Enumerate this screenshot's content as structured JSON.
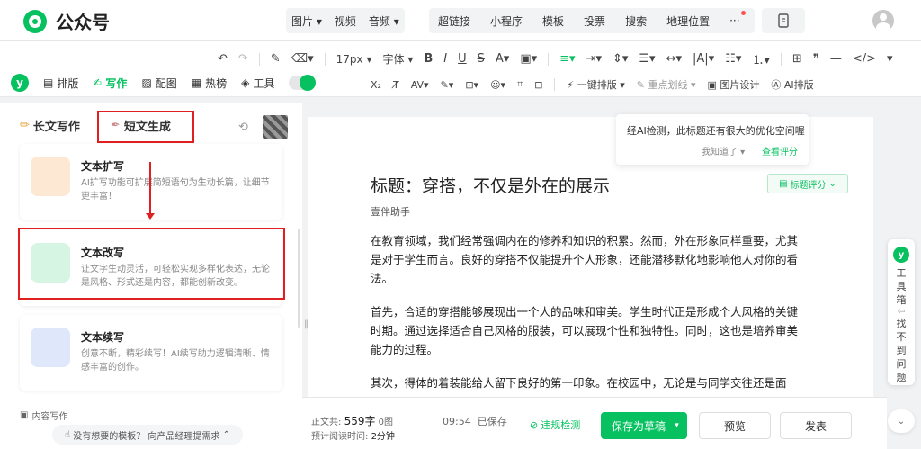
{
  "header": {
    "logo_text": "公众号",
    "media": [
      "图片",
      "视频",
      "音频"
    ],
    "insert": [
      "超链接",
      "小程序",
      "模板",
      "投票",
      "搜索",
      "地理位置"
    ],
    "more": "···"
  },
  "toolbar": {
    "font_size": "17px",
    "font_family": "字体",
    "one_click_layout": "一键排版",
    "key_point": "重点划线",
    "image_design": "图片设计",
    "ai_layout": "AI排版"
  },
  "side_tabs": {
    "logo_letter": "y",
    "items": [
      "排版",
      "写作",
      "配图",
      "热榜",
      "工具"
    ]
  },
  "left_panel": {
    "mode_long": "长文写作",
    "mode_short": "短文生成",
    "cards": [
      {
        "title": "文本扩写",
        "desc": "AI扩写功能可扩展简短语句为生动长篇，让细节更丰富！"
      },
      {
        "title": "文本改写",
        "desc": "让文字生动灵活，可轻松实现多样化表达，无论是风格、形式还是内容，都能创新改变。"
      },
      {
        "title": "文本续写",
        "desc": "创意不断，精彩续写！AI续写助力逻辑清晰、情感丰富的创作。"
      }
    ],
    "section_label": "内容写作",
    "feedback": "没有想要的模板？ 向产品经理提需求"
  },
  "ai_tip": {
    "text": "经AI检测，此标题还有很大的优化空间喔",
    "dismiss": "我知道了",
    "view": "查看评分"
  },
  "article": {
    "title": "标题：穿搭，不仅是外在的展示",
    "title_score": "标题评分",
    "author": "壹伴助手",
    "paragraphs": [
      "在教育领域，我们经常强调内在的修养和知识的积累。然而，外在形象同样重要，尤其是对于学生而言。良好的穿搭不仅能提升个人形象，还能潜移默化地影响他人对你的看法。",
      "首先，合适的穿搭能够展现出一个人的品味和审美。学生时代正是形成个人风格的关键时期。通过选择适合自己风格的服装，可以展现个性和独特性。同时，这也是培养审美能力的过程。",
      "其次，得体的着装能给人留下良好的第一印象。在校园中，无论是与同学交往还是面"
    ]
  },
  "right_float": {
    "logo_letter": "y",
    "toolbox": "工具箱",
    "find": "找不到问题"
  },
  "bottombar": {
    "body_label": "正文共:",
    "word_count": "559字",
    "image_count": "0图",
    "read_label": "预计阅读时间:",
    "read_time": "2分钟",
    "saved_time": "09:54",
    "saved_text": "已保存",
    "check": "违规检测",
    "save_draft": "保存为草稿",
    "preview": "预览",
    "publish": "发表"
  }
}
